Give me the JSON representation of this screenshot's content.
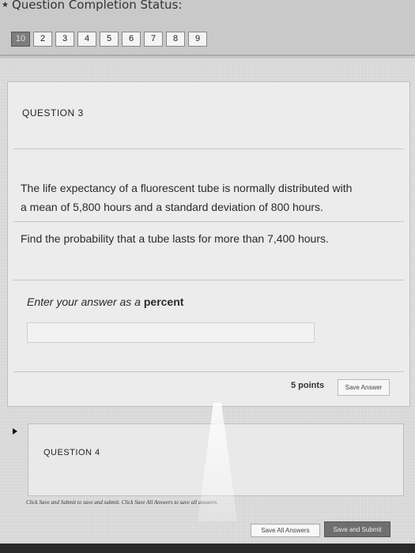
{
  "header": {
    "title": "Question Completion Status:",
    "question_numbers": [
      "10",
      "2",
      "3",
      "4",
      "5",
      "6",
      "7",
      "8",
      "9"
    ],
    "current_index": 0
  },
  "question3": {
    "title": "QUESTION 3",
    "text_line1": "The life expectancy of a fluorescent tube is normally distributed with",
    "text_line2": "a mean of 5,800 hours and a standard deviation of 800 hours.",
    "prompt": "Find the probability that a tube lasts for more than 7,400 hours.",
    "answer_label_prefix": "Enter your answer as a",
    "answer_label_bold": "percent",
    "answer_value": "",
    "points": "5 points",
    "save_answer_label": "Save Answer"
  },
  "question4": {
    "title": "QUESTION 4"
  },
  "footer": {
    "note": "Click Save and Submit to save and submit. Click Save All Answers to save all answers.",
    "save_all_label": "Save All Answers",
    "save_submit_label": "Save and Submit"
  },
  "colors": {
    "background": "#d8d8d8",
    "card": "#ececec",
    "current_question": "#7d7d7d",
    "submit_button": "#6f6f6f"
  },
  "icons": {
    "header": "star-icon",
    "expand": "triangle-right-icon"
  }
}
